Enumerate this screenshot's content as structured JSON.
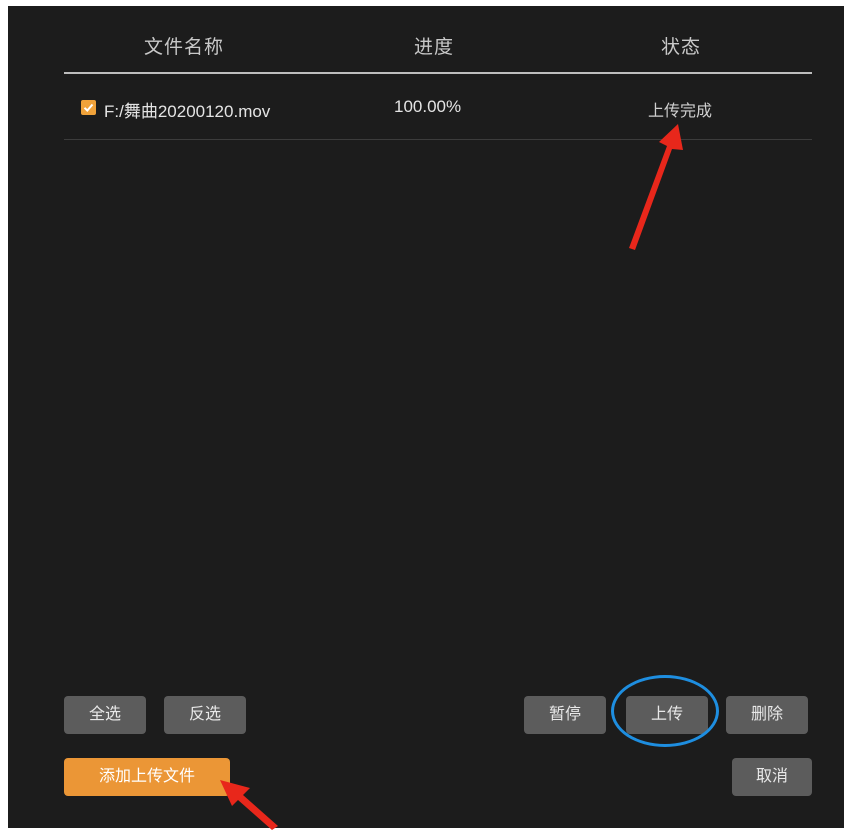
{
  "table": {
    "headers": {
      "name": "文件名称",
      "progress": "进度",
      "status": "状态"
    },
    "rows": [
      {
        "checked": true,
        "name": "F:/舞曲20200120.mov",
        "progress": "100.00%",
        "status": "上传完成"
      }
    ]
  },
  "buttons": {
    "select_all": "全选",
    "invert": "反选",
    "pause": "暂停",
    "upload": "上传",
    "delete": "删除",
    "add_upload_file": "添加上传文件",
    "cancel": "取消"
  },
  "colors": {
    "background": "#1c1c1c",
    "accent_orange": "#eb9636",
    "button_gray": "#5c5c5c",
    "highlight_blue": "#1e8ee0",
    "arrow_red": "#e8271b"
  },
  "annotations": {
    "arrows": [
      "status-arrow",
      "add-file-arrow"
    ],
    "highlight": "upload-button-circle"
  }
}
